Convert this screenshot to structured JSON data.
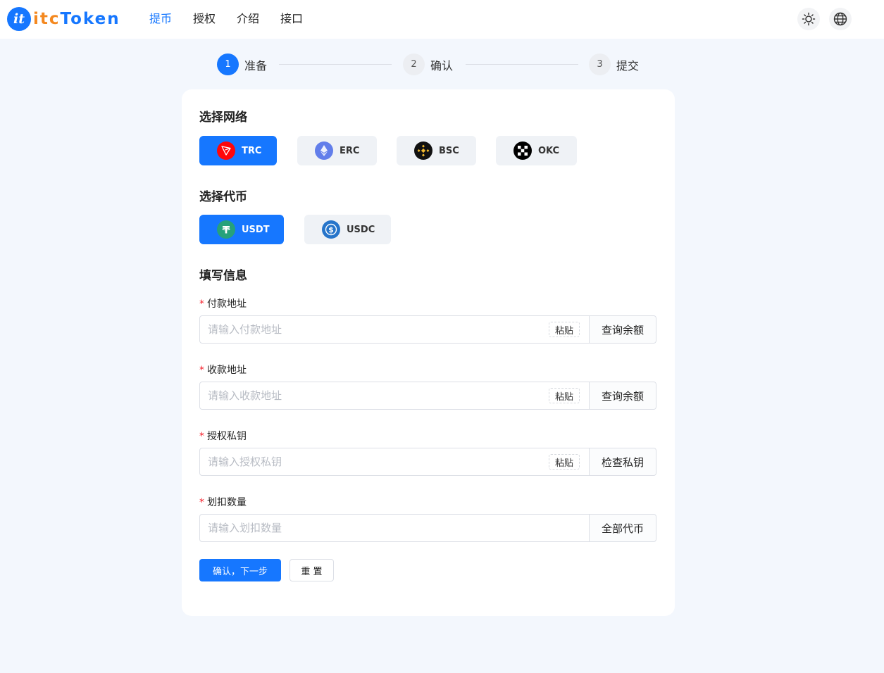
{
  "header": {
    "logo_badge": "it",
    "logo_text_a": "itc",
    "logo_text_b": "Token",
    "nav": [
      "提币",
      "授权",
      "介绍",
      "接口"
    ],
    "active_nav": "提币",
    "theme_icon": "sun-icon",
    "language_icon": "globe-icon"
  },
  "steps": [
    {
      "num": "1",
      "label": "准备",
      "active": true
    },
    {
      "num": "2",
      "label": "确认",
      "active": false
    },
    {
      "num": "3",
      "label": "提交",
      "active": false
    }
  ],
  "network": {
    "title": "选择网络",
    "options": [
      {
        "label": "TRC",
        "icon": "tron-icon",
        "color": "#ff060a",
        "selected": true
      },
      {
        "label": "ERC",
        "icon": "ethereum-icon",
        "color": "#627eea",
        "selected": false
      },
      {
        "label": "BSC",
        "icon": "binance-icon",
        "color": "#f3ba2f",
        "selected": false
      },
      {
        "label": "OKC",
        "icon": "okx-icon",
        "color": "#000000",
        "selected": false
      }
    ]
  },
  "token": {
    "title": "选择代币",
    "options": [
      {
        "label": "USDT",
        "icon": "tether-icon",
        "color": "#26a17b",
        "selected": true
      },
      {
        "label": "USDC",
        "icon": "usdc-icon",
        "color": "#2775ca",
        "selected": false
      }
    ]
  },
  "form": {
    "title": "填写信息",
    "fields": [
      {
        "label": "付款地址",
        "placeholder": "请输入付款地址",
        "paste": "粘贴",
        "button": "查询余额"
      },
      {
        "label": "收款地址",
        "placeholder": "请输入收款地址",
        "paste": "粘贴",
        "button": "查询余额"
      },
      {
        "label": "授权私钥",
        "placeholder": "请输入授权私钥",
        "paste": "粘贴",
        "button": "检查私钥"
      },
      {
        "label": "划扣数量",
        "placeholder": "请输入划扣数量",
        "button": "全部代币"
      }
    ],
    "required_mark": "*",
    "submit": "确认，下一步",
    "reset": "重 置"
  },
  "colors": {
    "primary": "#1677ff",
    "background": "#f3f7fd",
    "required": "#f5222d"
  }
}
